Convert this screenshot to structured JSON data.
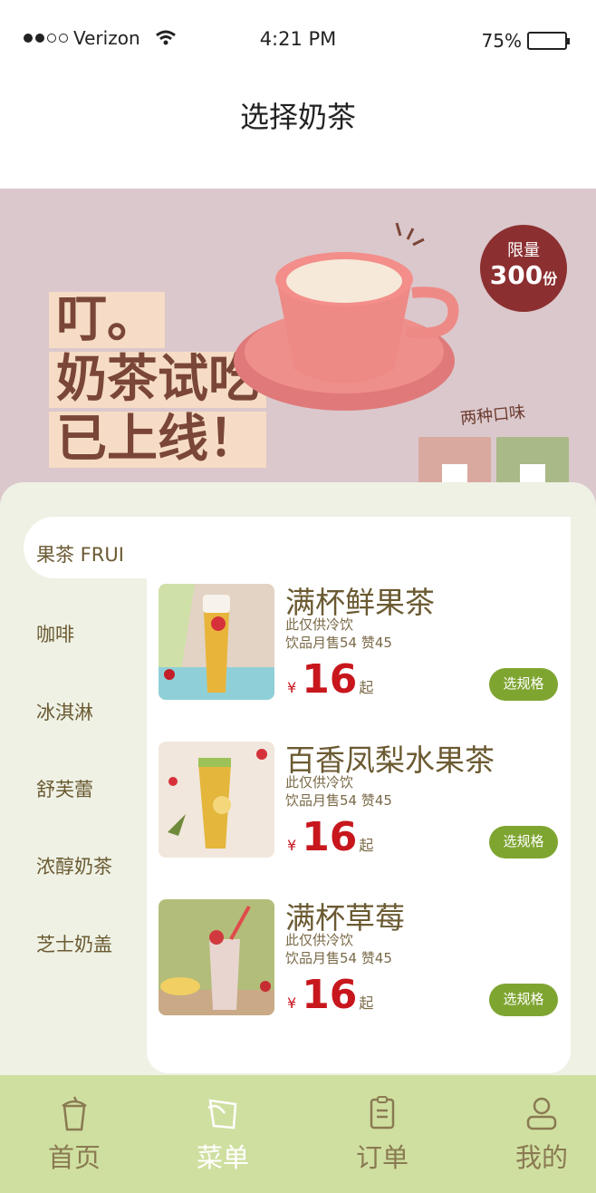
{
  "status_bar": {
    "carrier": "Verizon",
    "time": "4:21 PM",
    "battery": "75%",
    "battery_level": 0.75
  },
  "header": {
    "title": "选择奶茶"
  },
  "banner": {
    "lines": [
      "叮。",
      "奶茶试吃",
      "已上线！"
    ],
    "badge_top": "限量",
    "badge_num": "300",
    "badge_unit": "份",
    "flavor_label": "两种口味"
  },
  "sidebar": {
    "items": [
      {
        "label": "果茶 FRUI"
      },
      {
        "label": "咖啡"
      },
      {
        "label": "冰淇淋"
      },
      {
        "label": "舒芙蕾"
      },
      {
        "label": "浓醇奶茶"
      },
      {
        "label": "芝士奶盖"
      }
    ]
  },
  "products": [
    {
      "name": "满杯鲜果茶",
      "note": "此仅供冷饮",
      "sales": "饮品月售54   赞45",
      "currency": "¥",
      "price": "16",
      "suffix": "起",
      "button": "选规格"
    },
    {
      "name": "百香凤梨水果茶",
      "note": "此仅供冷饮",
      "sales": "饮品月售54   赞45",
      "currency": "¥",
      "price": "16",
      "suffix": "起",
      "button": "选规格"
    },
    {
      "name": "满杯草莓",
      "note": "此仅供冷饮",
      "sales": "饮品月售54   赞45",
      "currency": "¥",
      "price": "16",
      "suffix": "起",
      "button": "选规格"
    }
  ],
  "tab_bar": {
    "tabs": [
      {
        "label": "首页",
        "icon": "cup-icon"
      },
      {
        "label": "菜单",
        "icon": "menu-icon"
      },
      {
        "label": "订单",
        "icon": "clipboard-icon"
      },
      {
        "label": "我的",
        "icon": "user-icon"
      }
    ],
    "active_index": 1
  },
  "colors": {
    "accent_green": "#7fa531",
    "price_red": "#c8161d",
    "tab_bg": "#cfdfa0",
    "panel_bg": "#eef1e4",
    "banner_bg": "#dbc8cc",
    "brown_text": "#6b5a32"
  }
}
